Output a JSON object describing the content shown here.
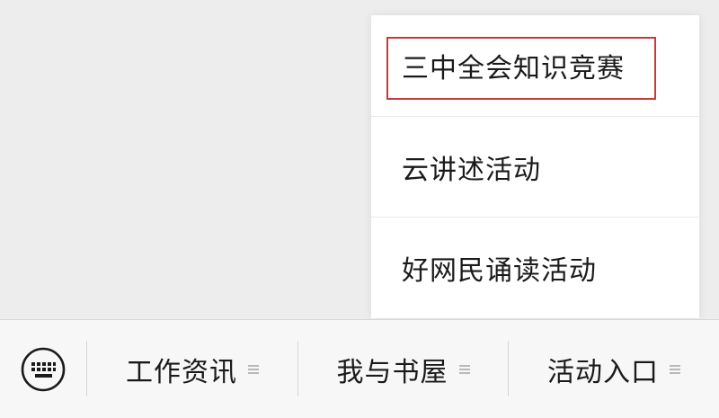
{
  "submenu": {
    "items": [
      {
        "label": "三中全会知识竞赛",
        "highlighted": true
      },
      {
        "label": "云讲述活动"
      },
      {
        "label": "好网民诵读活动"
      }
    ],
    "highlight_color": "#c83a3a"
  },
  "menubar": {
    "keyboard_icon": "keyboard-icon",
    "items": [
      {
        "label": "工作资讯"
      },
      {
        "label": "我与书屋"
      },
      {
        "label": "活动入口"
      }
    ]
  }
}
